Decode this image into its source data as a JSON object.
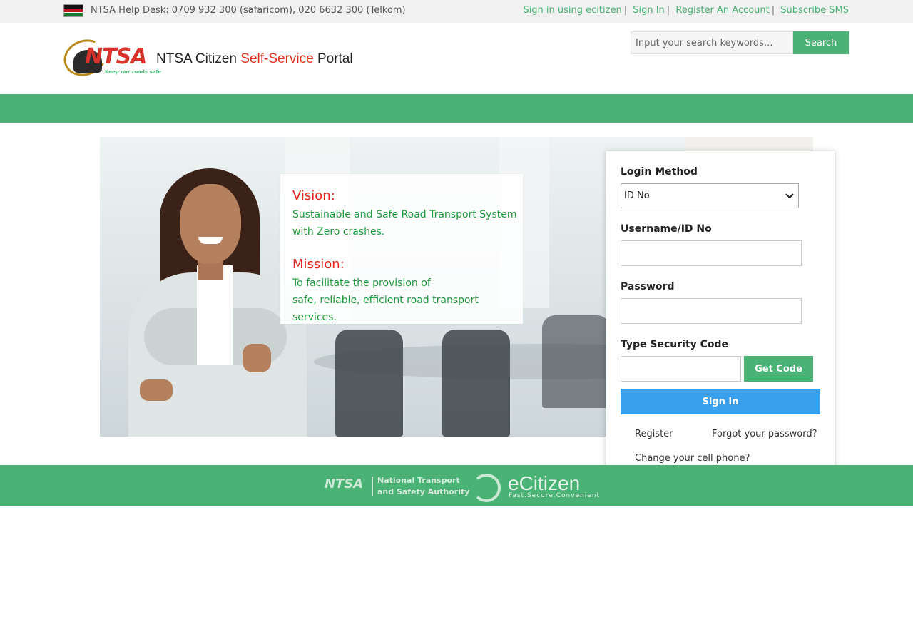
{
  "topbar": {
    "helpdesk": "NTSA Help Desk: 0709 932 300 (safaricom), 020 6632 300 (Telkom)",
    "links": [
      {
        "label": "Sign in using ecitizen"
      },
      {
        "label": "Sign In"
      },
      {
        "label": "Register An Account"
      },
      {
        "label": "Subscribe SMS"
      }
    ],
    "separator": "|"
  },
  "header": {
    "logo_text": "NTSA",
    "logo_tagline": "Keep our roads safe",
    "portal_title_prefix": "NTSA Citizen ",
    "portal_title_highlight": "Self-Service",
    "portal_title_suffix": " Portal",
    "search": {
      "placeholder": "Input your search keywords...",
      "button_label": "Search"
    }
  },
  "hero": {
    "vision_heading": "Vision:",
    "vision_text": "Sustainable and Safe Road Transport System with Zero crashes.",
    "mission_heading": "Mission:",
    "mission_text_1": "To facilitate the provision of",
    "mission_text_2": "safe, reliable, efficient road transport services."
  },
  "login": {
    "method_label": "Login Method",
    "method_value": "ID No",
    "username_label": "Username/ID No",
    "username_value": "",
    "password_label": "Password",
    "password_value": "",
    "security_label": "Type Security Code",
    "security_value": "",
    "get_code_label": "Get Code",
    "sign_in_label": "Sign In",
    "register_link": "Register",
    "forgot_link": "Forgot your password?",
    "change_phone_link": "Change your cell phone?"
  },
  "footer": {
    "ntsa_logo": "NTSA",
    "ntsa_name_1": "National Transport",
    "ntsa_name_2": "and Safety Authority",
    "ecitizen_name": "eCitizen",
    "ecitizen_slogan": "Fast.Secure.Convenient"
  },
  "colors": {
    "brand_green": "#4ab274",
    "accent_red": "#e2231a",
    "signin_blue": "#38a0ec"
  },
  "icons": [
    "kenya-flag-icon",
    "chevron-down-icon",
    "ntsa-logo",
    "ecitizen-logo-icon"
  ]
}
